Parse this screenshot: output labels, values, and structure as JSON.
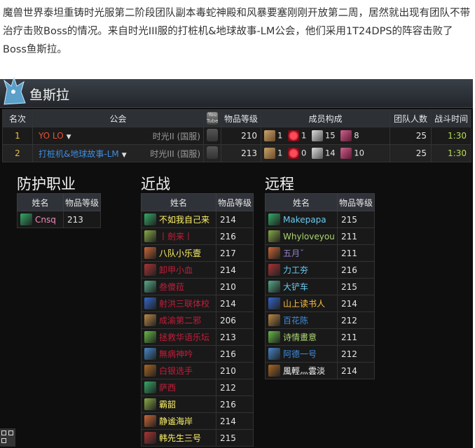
{
  "intro": "魔兽世界泰坦重铸时光服第二阶段团队副本毒蛇神殿和风暴要塞刚刚开放第二周，居然就出现有团队不带治疗击败Boss的情况。来自时光III服的打桩机&地球故事-LM公会，他们采用1T24DPS的阵容击败了Boss鱼斯拉。",
  "boss": {
    "name": "鱼斯拉"
  },
  "rank_table": {
    "headers": {
      "rank": "名次",
      "guild": "公会",
      "video": "You Tube",
      "ilvl": "物品等级",
      "composition": "成员构成",
      "size": "团队人数",
      "time": "战斗时间"
    },
    "rows": [
      {
        "rank": "1",
        "guild": "YO LO",
        "server": "时光II (国服)",
        "ilvl": "210",
        "tank": "1",
        "heal": "1",
        "melee": "15",
        "ranged": "8",
        "size": "25",
        "time": "1:30",
        "guild_color": "#e85030"
      },
      {
        "rank": "2",
        "guild": "打桩机&地球故事-LM",
        "server": "时光III (国服)",
        "ilvl": "213",
        "tank": "1",
        "heal": "0",
        "melee": "14",
        "ranged": "10",
        "size": "25",
        "time": "1:30",
        "guild_color": "#3d8de0"
      }
    ]
  },
  "sections": {
    "tank": {
      "title": "防护职业",
      "col_name": "姓名",
      "col_ilvl": "物品等级",
      "members": [
        {
          "name": "Cnsq",
          "ilvl": "213",
          "color": "#f58cba"
        }
      ]
    },
    "melee": {
      "title": "近战",
      "col_name": "姓名",
      "col_ilvl": "物品等级",
      "members": [
        {
          "name": "不如我自己来",
          "ilvl": "214",
          "color": "#fff468"
        },
        {
          "name": "丨劍来丨",
          "ilvl": "216",
          "color": "#c41e3a"
        },
        {
          "name": "八队小乐壹",
          "ilvl": "217",
          "color": "#fff468"
        },
        {
          "name": "卸甲小血",
          "ilvl": "214",
          "color": "#c41e3a"
        },
        {
          "name": "叁傻菈",
          "ilvl": "210",
          "color": "#c41e3a"
        },
        {
          "name": "射洪三联体校",
          "ilvl": "214",
          "color": "#c41e3a"
        },
        {
          "name": "成渝第二邪",
          "ilvl": "206",
          "color": "#c41e3a"
        },
        {
          "name": "拯救华语乐坛",
          "ilvl": "213",
          "color": "#c41e3a"
        },
        {
          "name": "無病神吟",
          "ilvl": "216",
          "color": "#c41e3a"
        },
        {
          "name": "白银选手",
          "ilvl": "210",
          "color": "#c41e3a"
        },
        {
          "name": "萨西",
          "ilvl": "212",
          "color": "#c41e3a"
        },
        {
          "name": "霸韶",
          "ilvl": "216",
          "color": "#fff468"
        },
        {
          "name": "静谧海岸",
          "ilvl": "214",
          "color": "#fff468"
        },
        {
          "name": "韩先生三号",
          "ilvl": "215",
          "color": "#fff468"
        }
      ]
    },
    "ranged": {
      "title": "远程",
      "col_name": "姓名",
      "col_ilvl": "物品等级",
      "members": [
        {
          "name": "Makepapa",
          "ilvl": "215",
          "color": "#69ccf0"
        },
        {
          "name": "Whyloveyou",
          "ilvl": "211",
          "color": "#abd473"
        },
        {
          "name": "五月ˇ",
          "ilvl": "211",
          "color": "#9482c9"
        },
        {
          "name": "力工夯",
          "ilvl": "216",
          "color": "#69ccf0"
        },
        {
          "name": "大铲车",
          "ilvl": "215",
          "color": "#69ccf0"
        },
        {
          "name": "山上读书人",
          "ilvl": "214",
          "color": "#ffc040"
        },
        {
          "name": "百花陈",
          "ilvl": "212",
          "color": "#3d8de0"
        },
        {
          "name": "诗情畫意",
          "ilvl": "211",
          "color": "#abd473"
        },
        {
          "name": "阿德一号",
          "ilvl": "212",
          "color": "#3d8de0"
        },
        {
          "name": "風輕灬雲淡",
          "ilvl": "214",
          "color": "#ffffff"
        }
      ]
    }
  }
}
